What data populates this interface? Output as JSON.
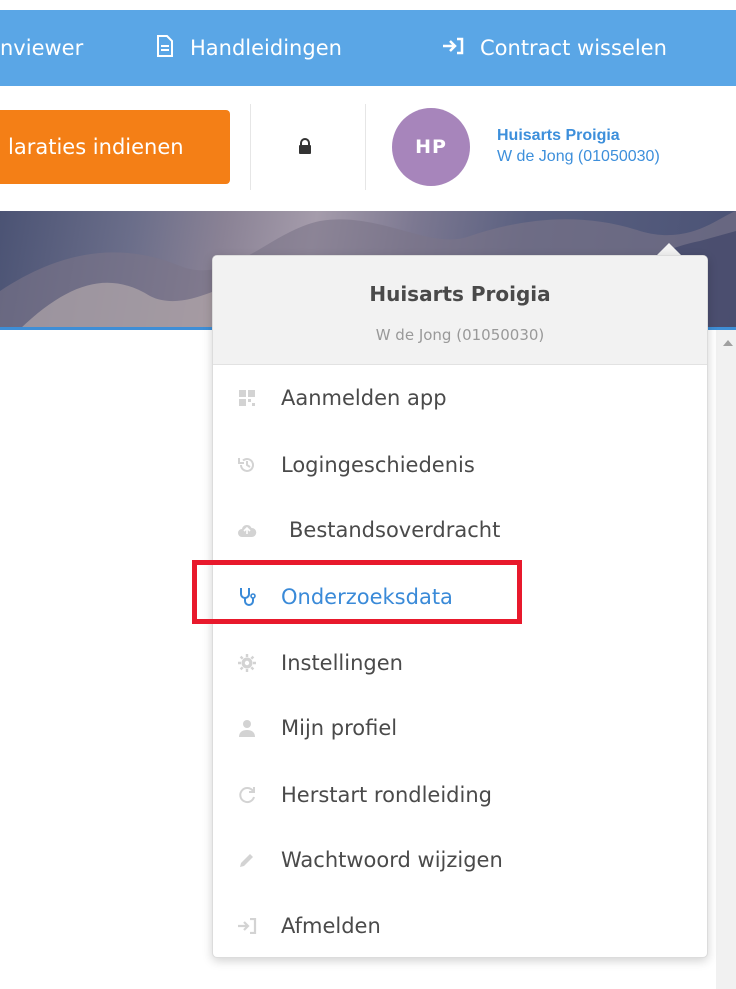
{
  "topbar": {
    "items": [
      {
        "label": "nviewer",
        "icon": ""
      },
      {
        "label": "Handleidingen",
        "icon": "document-icon"
      },
      {
        "label": "Contract wisselen",
        "icon": "switch-arrow-icon"
      }
    ]
  },
  "toolbar": {
    "submit_label": "laraties indienen",
    "lock_icon": "lock-icon"
  },
  "user": {
    "initials": "HP",
    "name": "Huisarts Proigia",
    "id": "W de Jong (01050030)",
    "avatar_color": "#a785bb"
  },
  "dropdown": {
    "name": "Huisarts Proigia",
    "id": "W de Jong (01050030)",
    "items": [
      {
        "label": "Aanmelden app",
        "icon": "qr-code-icon"
      },
      {
        "label": "Logingeschiedenis",
        "icon": "history-icon"
      },
      {
        "label": "Bestandsoverdracht",
        "icon": "cloud-upload-icon"
      },
      {
        "label": "Onderzoeksdata",
        "icon": "stethoscope-icon",
        "active": true
      },
      {
        "label": "Instellingen",
        "icon": "gear-icon"
      },
      {
        "label": "Mijn profiel",
        "icon": "user-icon"
      },
      {
        "label": "Herstart rondleiding",
        "icon": "restart-icon"
      },
      {
        "label": "Wachtwoord wijzigen",
        "icon": "pencil-icon"
      },
      {
        "label": "Afmelden",
        "icon": "sign-out-icon"
      }
    ]
  },
  "colors": {
    "nav_blue": "#5aa6e6",
    "orange": "#f47f16",
    "link_blue": "#3d8fdb",
    "highlight_red": "#e8192c"
  }
}
